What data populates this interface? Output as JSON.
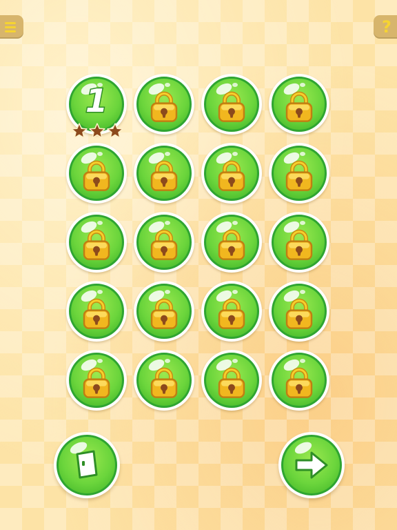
{
  "top_bar": {
    "menu_icon": "menu-icon",
    "help_label": "?"
  },
  "levels": [
    {
      "number": "1",
      "locked": false,
      "stars": 3
    },
    {
      "locked": true
    },
    {
      "locked": true
    },
    {
      "locked": true
    },
    {
      "locked": true
    },
    {
      "locked": true
    },
    {
      "locked": true
    },
    {
      "locked": true
    },
    {
      "locked": true
    },
    {
      "locked": true
    },
    {
      "locked": true
    },
    {
      "locked": true
    },
    {
      "locked": true
    },
    {
      "locked": true
    },
    {
      "locked": true
    },
    {
      "locked": true
    },
    {
      "locked": true
    },
    {
      "locked": true
    },
    {
      "locked": true
    },
    {
      "locked": true
    }
  ],
  "bottom_bar": {
    "exit_icon": "exit-door-icon",
    "next_icon": "arrow-right-icon"
  },
  "colors": {
    "orb_green": "#6bd53c",
    "orb_border": "#2fa531",
    "lock_gold": "#f1b71f",
    "star_brown": "#8c4a1c",
    "background": "#fde3a6"
  }
}
